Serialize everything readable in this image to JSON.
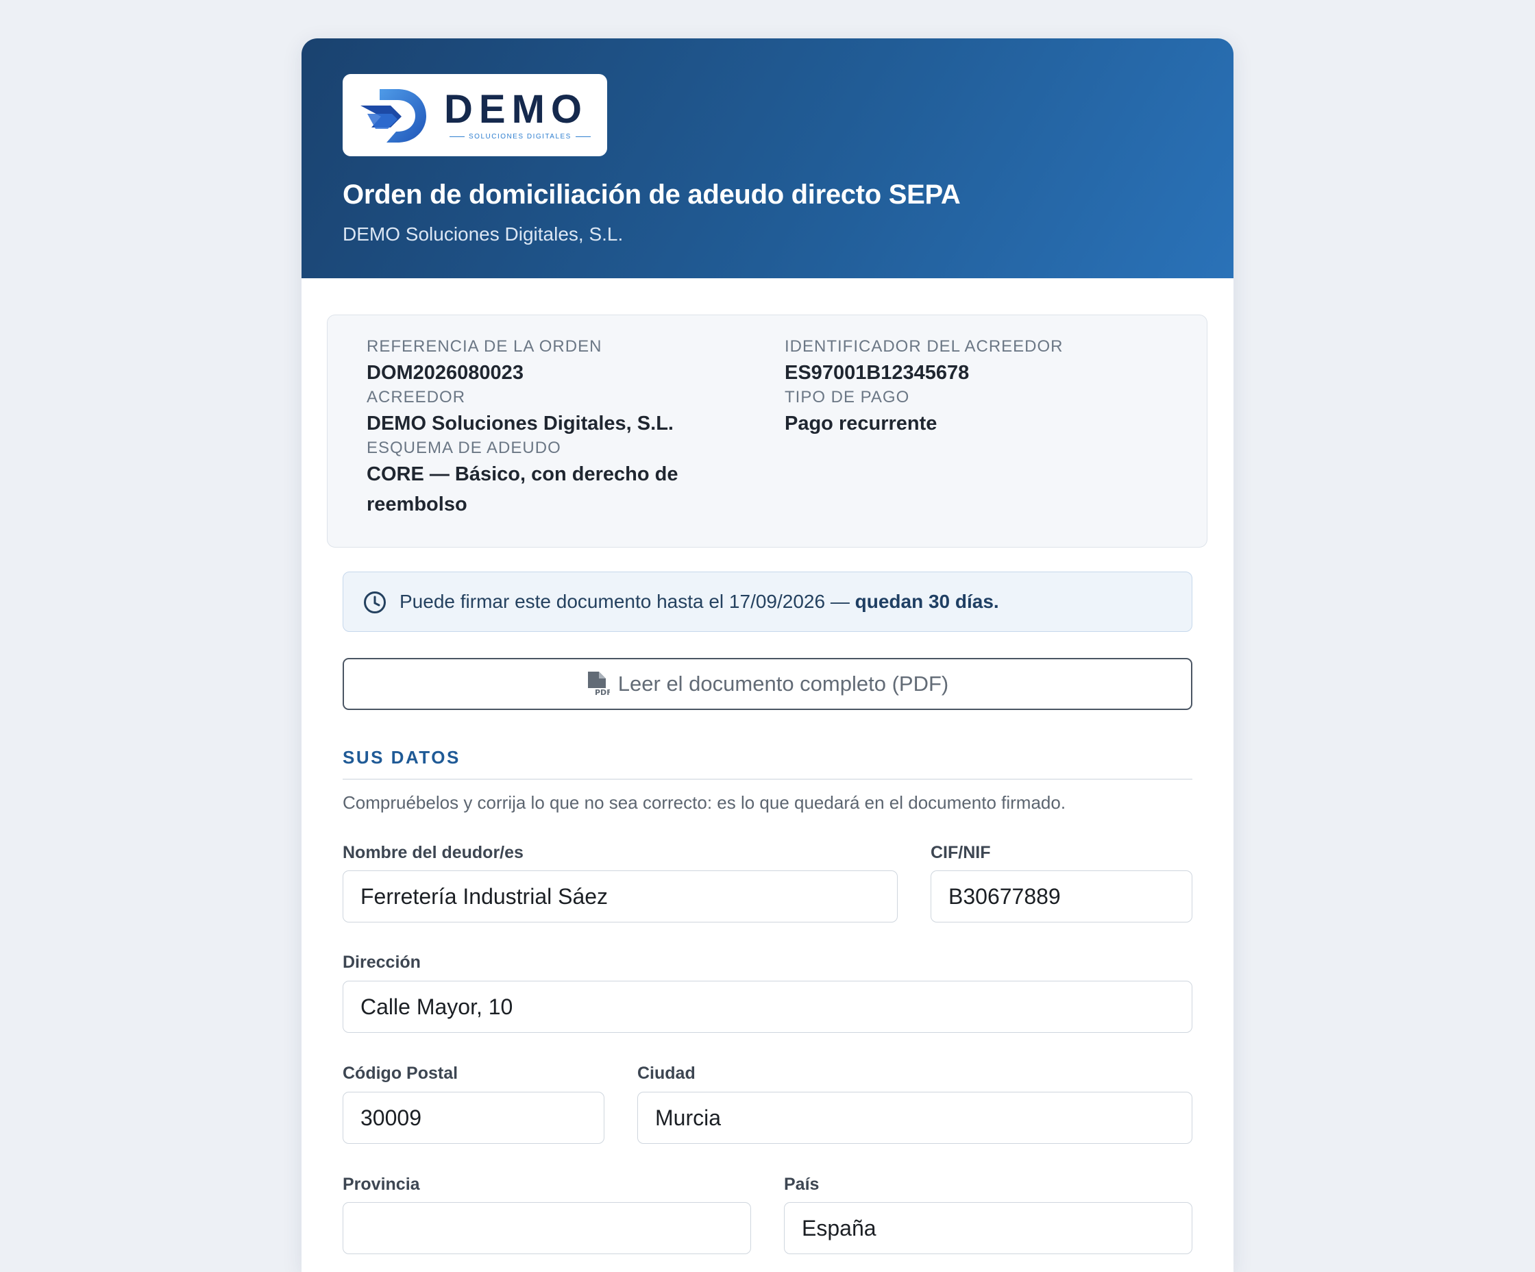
{
  "logo": {
    "word": "DEMO",
    "sub": "SOLUCIONES DIGITALES"
  },
  "header": {
    "title": "Orden de domiciliación de adeudo directo SEPA",
    "subtitle": "DEMO Soluciones Digitales, S.L."
  },
  "order_info": {
    "reference_label": "REFERENCIA DE LA ORDEN",
    "reference_value": "DOM2026080023",
    "creditor_label": "ACREEDOR",
    "creditor_value": "DEMO Soluciones Digitales, S.L.",
    "scheme_label": "ESQUEMA DE ADEUDO",
    "scheme_value": "CORE — Básico, con derecho de reembolso",
    "creditor_id_label": "IDENTIFICADOR DEL ACREEDOR",
    "creditor_id_value": "ES97001B12345678",
    "payment_type_label": "TIPO DE PAGO",
    "payment_type_value": "Pago recurrente"
  },
  "notice": {
    "text": "Puede firmar este documento hasta el 17/09/2026 — ",
    "emphasis": "quedan 30 días."
  },
  "pdf_button": {
    "label": "Leer el documento completo (PDF)"
  },
  "section": {
    "title": "SUS DATOS",
    "help": "Compruébelos y corrija lo que no sea correcto: es lo que quedará en el documento firmado."
  },
  "form": {
    "debtor_name": {
      "label": "Nombre del deudor/es",
      "value": "Ferretería Industrial Sáez"
    },
    "tax_id": {
      "label": "CIF/NIF",
      "value": "B30677889"
    },
    "address": {
      "label": "Dirección",
      "value": "Calle Mayor, 10"
    },
    "postal_code": {
      "label": "Código Postal",
      "value": "30009"
    },
    "city": {
      "label": "Ciudad",
      "value": "Murcia"
    },
    "province": {
      "label": "Provincia",
      "value": ""
    },
    "country": {
      "label": "País",
      "value": "España"
    }
  },
  "colors": {
    "header_start": "#1a426f",
    "header_end": "#2a72b8",
    "accent": "#1f5a96"
  }
}
